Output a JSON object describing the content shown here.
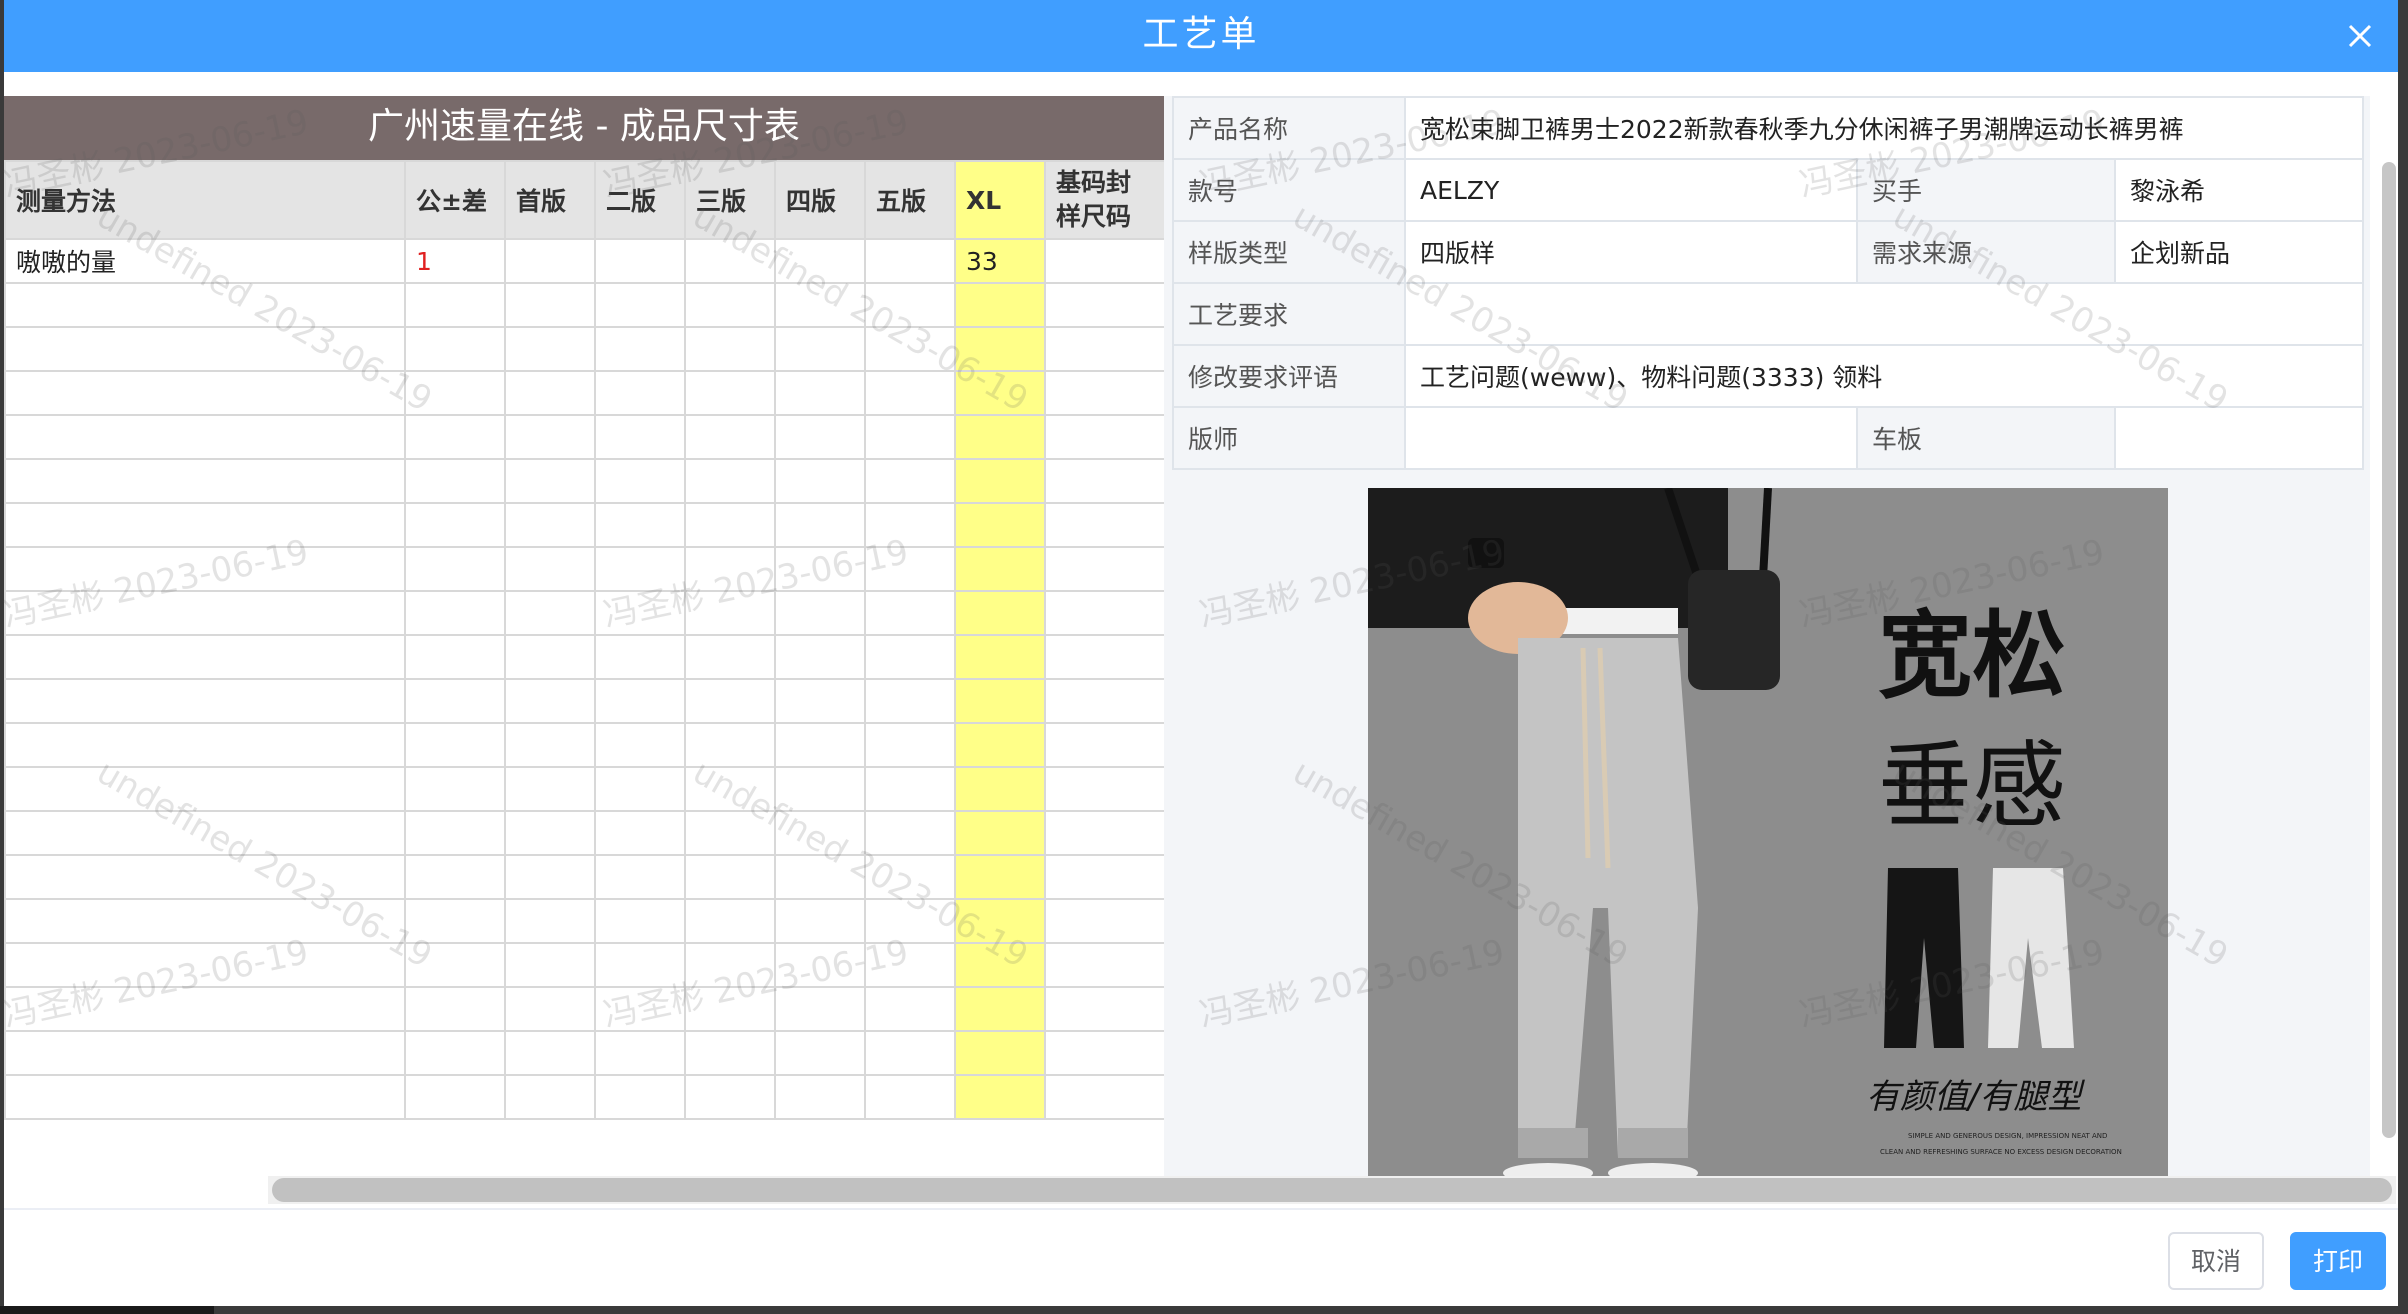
{
  "dialog": {
    "title": "工艺单",
    "cancel_label": "取消",
    "print_label": "打印"
  },
  "size_sheet": {
    "title": "广州速量在线 - 成品尺寸表",
    "headers": {
      "method": "测量方法",
      "tolerance": "公±差",
      "v1": "首版",
      "v2": "二版",
      "v3": "三版",
      "v4": "四版",
      "v5": "五版",
      "xl": "XL",
      "base": "基码封样尺码"
    },
    "rows": [
      {
        "method": "嗷嗷的量",
        "tolerance": "1",
        "v1": "",
        "v2": "",
        "v3": "",
        "v4": "",
        "v5": "",
        "xl": "33",
        "base": ""
      }
    ],
    "empty_row_count": 19
  },
  "info": {
    "product_name_label": "产品名称",
    "product_name": "宽松束脚卫裤男士2022新款春秋季九分休闲裤子男潮牌运动长裤男裤",
    "style_no_label": "款号",
    "style_no": "AELZY",
    "buyer_label": "买手",
    "buyer": "黎泳希",
    "sample_type_label": "样版类型",
    "sample_type": "四版样",
    "demand_source_label": "需求来源",
    "demand_source": "企划新品",
    "craft_req_label": "工艺要求",
    "craft_req": "",
    "revision_label": "修改要求评语",
    "revision": "工艺问题(weww)、物料问题(3333) 领料",
    "pattern_maker_label": "版师",
    "pattern_maker": "",
    "sewing_label": "车板",
    "sewing": ""
  },
  "product_image": {
    "headline": "宽松",
    "subline": "垂感",
    "tagline": "有颜值/有腿型",
    "small_text_1": "SIMPLE AND GENEROUS DESIGN, IMPRESSION NEAT AND",
    "small_text_2": "CLEAN AND REFRESHING SURFACE NO EXCESS DESIGN DECORATION"
  },
  "watermark": {
    "name_date": "冯圣彬 2023-06-19",
    "undefined_date": "undefined 2023-06-19"
  },
  "colors": {
    "header_blue": "#409eff",
    "sheet_title_bg": "#786a6a",
    "xl_column_yellow": "#ffff88",
    "tolerance_red": "#e02020"
  }
}
